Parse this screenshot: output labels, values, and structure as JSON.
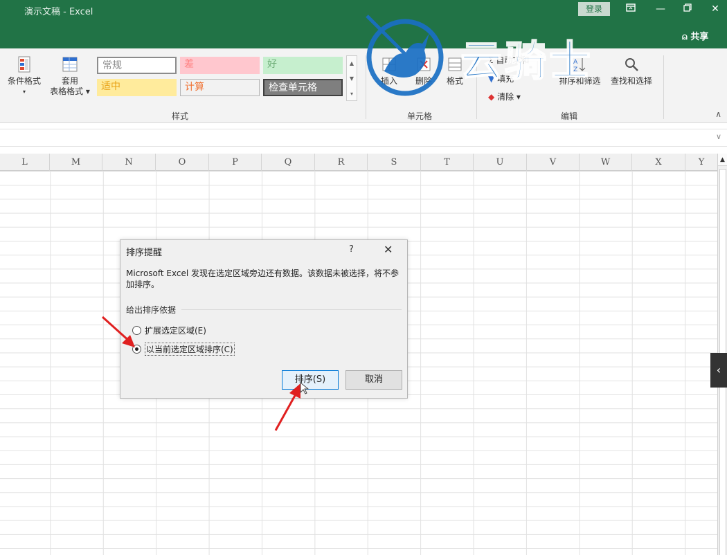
{
  "window": {
    "title": "演示文稿 - Excel",
    "login": "登录",
    "share": "共享",
    "icons": [
      "ribbon-display-icon",
      "minimize-icon",
      "restore-icon",
      "close-icon"
    ],
    "accent": "#217346"
  },
  "ribbon": {
    "conditional_format": "条件格式",
    "conditional_format_arrow": "▾",
    "table_format_line1": "套用",
    "table_format_line2": "表格格式 ▾",
    "styles": {
      "normal": "常规",
      "bad": "差",
      "good": "好",
      "neutral": "适中",
      "calculation": "计算",
      "check_cell": "检查单元格"
    },
    "styles_group": "样式",
    "insert": "插入",
    "delete": "删除",
    "format": "格式",
    "cells_group": "单元格",
    "autosum": "自动求和",
    "fill": "填充",
    "clear": "清除 ▾",
    "sort_filter": "排序和筛选",
    "find_select": "查找和选择",
    "editing_group": "编辑"
  },
  "grid": {
    "columns": [
      "L",
      "M",
      "N",
      "O",
      "P",
      "Q",
      "R",
      "S",
      "T",
      "U",
      "V",
      "W",
      "X",
      "Y"
    ]
  },
  "dialog": {
    "title": "排序提醒",
    "help": "?",
    "close": "✕",
    "message": "Microsoft Excel 发现在选定区域旁边还有数据。该数据未被选择，将不参加排序。",
    "group_label": "给出排序依据",
    "option_expand": "扩展选定区域(E)",
    "option_current": "以当前选定区域排序(C)",
    "selected_option": "option_current",
    "sort_button": "排序(S)",
    "cancel_button": "取消"
  },
  "watermark": {
    "text": "云骑士"
  }
}
